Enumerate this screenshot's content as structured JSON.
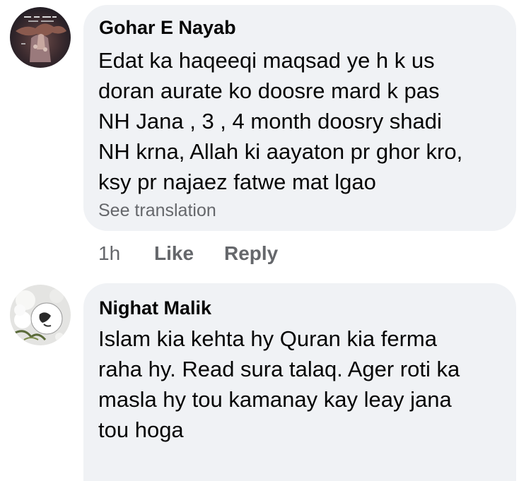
{
  "comments": [
    {
      "author": "Gohar E Nayab",
      "avatar_icon": "profile-photo-dark",
      "lines": [
        "Edat ka haqeeqi maqsad ye h k us",
        "doran aurate ko doosre mard k pas",
        "NH Jana , 3 , 4 month doosry shadi",
        "NH krna, Allah ki aayaton pr ghor kro,",
        "ksy pr najaez fatwe mat lgao"
      ],
      "see_translation": "See translation",
      "time": "1h",
      "like_label": "Like",
      "reply_label": "Reply"
    },
    {
      "author": "Nighat Malik",
      "avatar_icon": "profile-photo-flowers",
      "lines": [
        "Islam kia kehta hy Quran kia ferma",
        "raha hy. Read sura talaq. Ager roti ka",
        "masla hy tou kamanay kay leay jana",
        "tou hoga"
      ]
    }
  ],
  "colors": {
    "bubble": "#f0f2f5",
    "text": "#050505",
    "secondary": "#65676b"
  }
}
